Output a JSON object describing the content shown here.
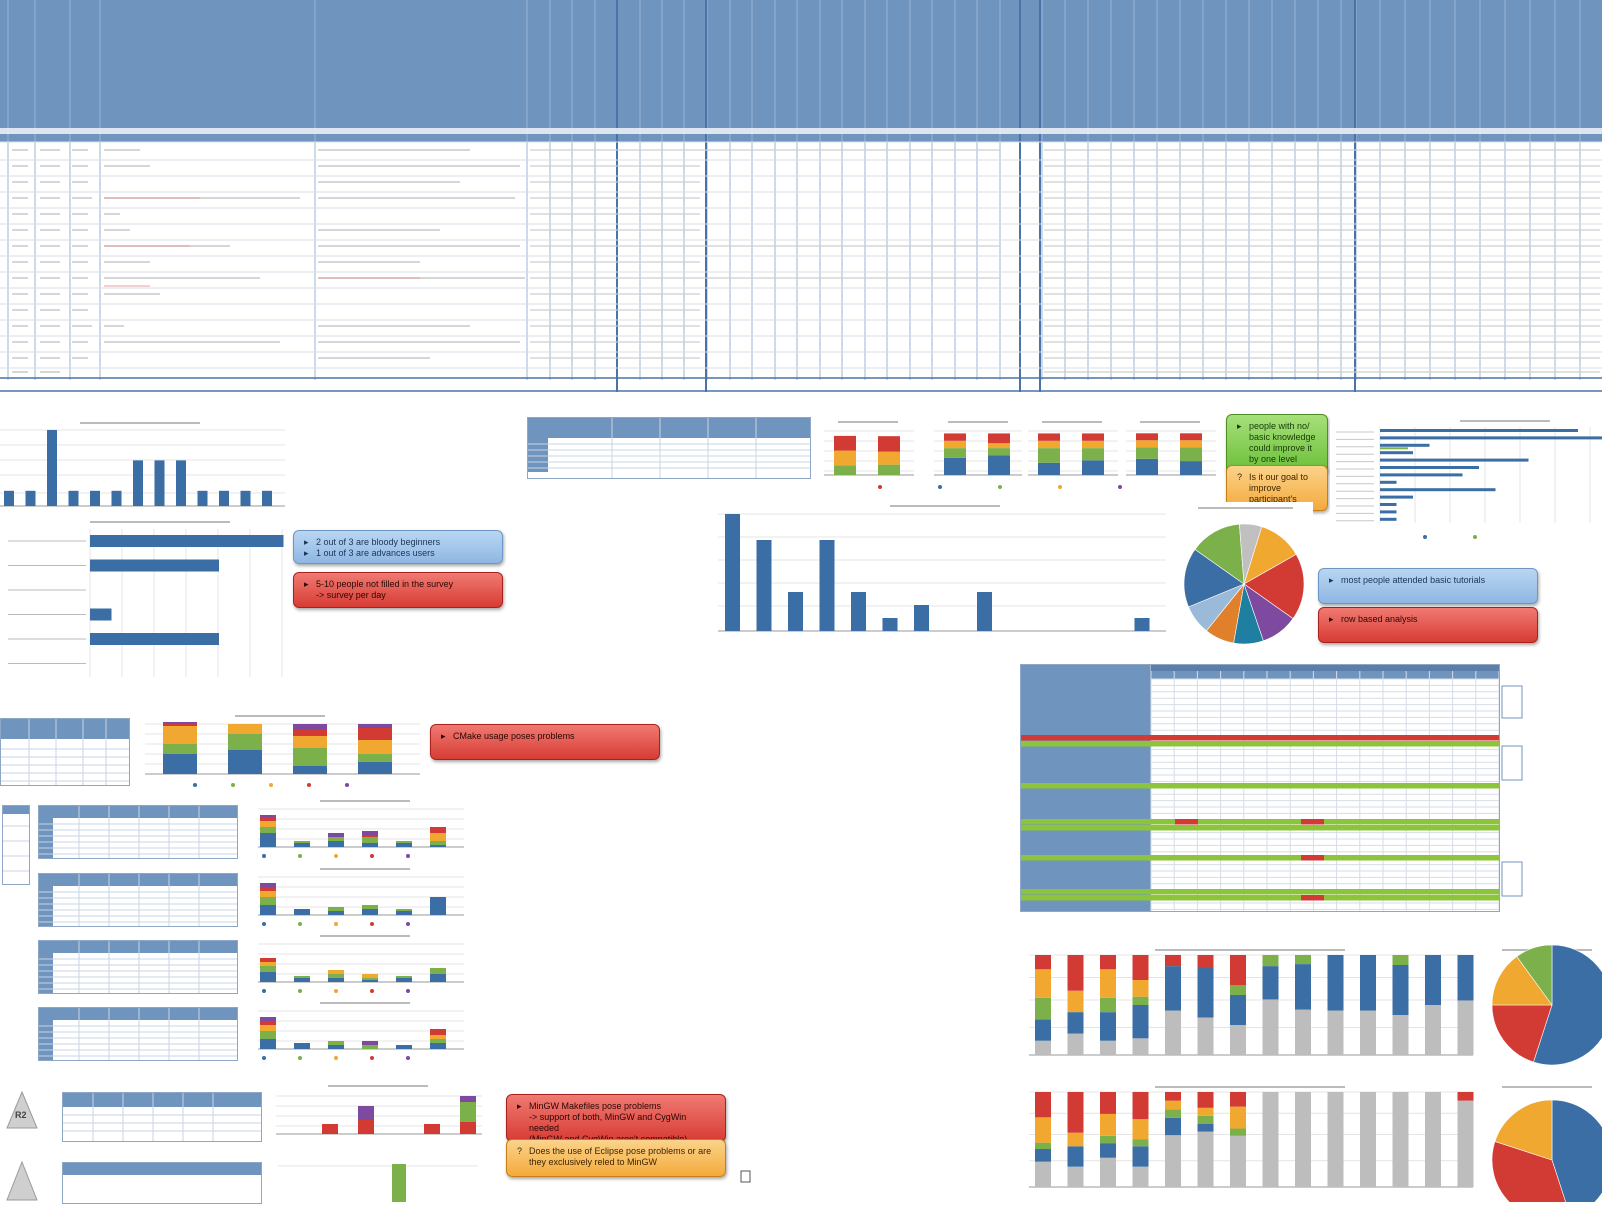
{
  "badge": {
    "label": "R2"
  },
  "callouts": {
    "beginners": [
      "2 out of 3 are bloody beginners",
      "1 out of 3 are advances users"
    ],
    "survey": [
      "5-10 people not filled in the survey",
      "-> survey per day"
    ],
    "cmake": "CMake usage poses problems",
    "knowledge": [
      "people with no/ basic knowledge could improve it by one level within the workshop"
    ],
    "goal": [
      "Is it our goal to improve participant's programming skills"
    ],
    "tutorials": "most people attended basic tutorials",
    "rowbased": "row based analysis",
    "mingw": [
      "MinGW Makefiles pose problems",
      "-> support of both, MinGW and CygWin needed",
      "(MinGW and CygWin aren't compatible)"
    ],
    "eclipse": [
      "Does the use of Eclipse pose problems or are they exclusively reled to MinGW"
    ]
  },
  "colors": {
    "header": "#6f94be",
    "bar": "#3a6ea5",
    "green": "#7bb04a",
    "orange": "#f0a830",
    "red": "#d23b34",
    "purple": "#7d4aa0",
    "grey": "#bdbdbd"
  },
  "chart_data": [
    {
      "type": "bar",
      "values": [
        2,
        2,
        10,
        2,
        2,
        2,
        6,
        6,
        6,
        2,
        2,
        2,
        2
      ]
    },
    {
      "type": "bar",
      "orientation": "horizontal",
      "values": [
        9,
        6,
        0,
        1,
        6,
        0
      ]
    },
    {
      "type": "bar",
      "values": [
        9,
        7,
        3,
        7,
        3,
        1,
        2,
        0,
        3,
        0,
        0,
        0,
        0,
        1
      ]
    },
    {
      "type": "pie",
      "values": [
        18,
        16,
        14,
        12,
        10,
        8,
        8,
        8,
        6
      ]
    },
    {
      "type": "bar",
      "orientation": "horizontal",
      "values": [
        12,
        14,
        3,
        2,
        9,
        6,
        5,
        1,
        7,
        2,
        1,
        1,
        1
      ]
    },
    {
      "type": "pie",
      "values": [
        55,
        20,
        15,
        10
      ]
    },
    {
      "type": "pie",
      "values": [
        45,
        35,
        20
      ]
    }
  ]
}
